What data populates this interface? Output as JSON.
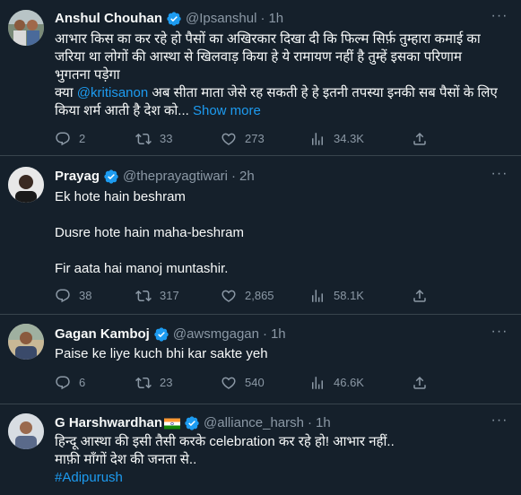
{
  "tweets": [
    {
      "name": "Anshul Chouhan",
      "handle": "@Ipsanshul",
      "time": "1h",
      "text_1": "आभार किस का कर रहे हो पैसों का अखिरकार दिखा दी कि फिल्म सिर्फ़ तुम्हारा कमाई का",
      "text_2": "जरिया था लोगों की आस्था से खिलवाड़ किया हे ये रामायण नहीं है तुम्हें इसका परिणाम",
      "text_3": "भुगतना पड़ेगा",
      "text_4a": "क्या ",
      "mention": "@kritisanon",
      "text_4b": " अब सीता माता जेसे रह सकती हे हे इतनी तपस्या इनकी सब पैसों के लिए",
      "text_5": "किया शर्म आती है देश को...",
      "show_more": " Show more",
      "replies": "2",
      "retweets": "33",
      "likes": "273",
      "views": "34.3K"
    },
    {
      "name": "Prayag",
      "handle": "@theprayagtiwari",
      "time": "2h",
      "line_1": "Ek hote hain beshram",
      "line_2": "Dusre hote hain maha-beshram",
      "line_3": "Fir aata hai manoj muntashir.",
      "replies": "38",
      "retweets": "317",
      "likes": "2,865",
      "views": "58.1K"
    },
    {
      "name": "Gagan Kamboj",
      "handle": "@awsmgagan",
      "time": "1h",
      "line_1": "Paise ke liye kuch bhi kar sakte yeh",
      "replies": "6",
      "retweets": "23",
      "likes": "540",
      "views": "46.6K"
    },
    {
      "name": "G Harshwardhan",
      "handle": "@alliance_harsh",
      "time": "1h",
      "line_1": "हिन्दू आस्था की इसी तैसी करके celebration कर रहे हो! आभार नहीं..",
      "line_2": "माफ़ी माँगों देश की जनता से..",
      "hashtag": "#Adipurush"
    }
  ],
  "separator": "·",
  "colors": {
    "background": "#15202b",
    "text": "#f7f9f9",
    "muted": "#8b98a5",
    "accent": "#1d9bf0",
    "divider": "#38444d"
  },
  "icons": [
    "reply-icon",
    "retweet-icon",
    "like-icon",
    "views-icon",
    "share-icon",
    "verified-badge-icon",
    "more-icon",
    "india-flag-icon"
  ]
}
